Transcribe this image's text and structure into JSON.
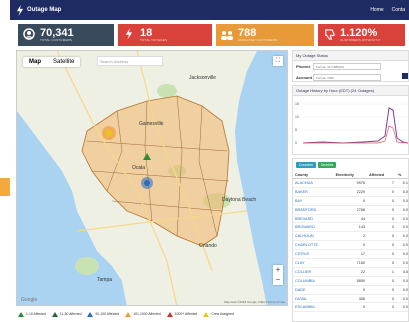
{
  "header": {
    "title": "Outage Map",
    "nav": [
      "Home",
      "Conta"
    ]
  },
  "stats": [
    {
      "icon": "user-circle-icon",
      "value": "70,341",
      "label": "TOTAL CUSTOMERS",
      "color": "#394a5c"
    },
    {
      "icon": "lightning-icon",
      "value": "18",
      "label": "TOTAL OUTAGES",
      "color": "#d9423b"
    },
    {
      "icon": "users-icon",
      "value": "788",
      "label": "AFFECTED CUSTOMERS",
      "color": "#e89a39"
    },
    {
      "icon": "thumbs-down-icon",
      "value": "1.120%",
      "label": "CUSTOMERS WITHOUT P",
      "color": "#d9423b"
    }
  ],
  "map": {
    "tabs": [
      "Map",
      "Satellite"
    ],
    "search_placeholder": "Search Address",
    "zoom_in": "+",
    "zoom_out": "−",
    "google": "Google",
    "attribution": "Map data ©2018 Google, INEGI  Terms of Use",
    "cities": [
      "Gainesville",
      "Jacksonville",
      "Ocala",
      "Orlando",
      "Tampa",
      "Daytona Beach"
    ]
  },
  "legend": [
    {
      "color": "#2e8b3f",
      "label": "1-10 Affected"
    },
    {
      "color": "#1c6b3a",
      "label": "11-50 Affected"
    },
    {
      "color": "#2b6bbf",
      "label": "51-100 Affected"
    },
    {
      "color": "#f0a030",
      "label": "101-1000 Affected"
    },
    {
      "color": "#c0392b",
      "label": "1000+ Affected"
    },
    {
      "color": "#e8c51a",
      "label": "Crew Assigned"
    }
  ],
  "outage_status": {
    "heading": "My Outage Status",
    "phone_label": "Phone#",
    "phone_placeholder": "Format: 3171985234",
    "account_label": "Account",
    "account_placeholder": "Format: 1556"
  },
  "history": {
    "heading": "Outage History by Hour (EDT) (24 Outages)",
    "y_ticks": [
      "15",
      "10",
      "5",
      "0"
    ]
  },
  "table": {
    "buttons": [
      "Counties",
      "Districts"
    ],
    "columns": [
      "County",
      "Electricity",
      "Affected",
      "%"
    ],
    "rows": [
      [
        "ALACHUA",
        "9976",
        "7",
        "0.1"
      ],
      [
        "BAKER",
        "2229",
        "0",
        "0.0"
      ],
      [
        "BAY",
        "0",
        "0",
        "0.0"
      ],
      [
        "BRADFORD",
        "2788",
        "0",
        "0.0"
      ],
      [
        "BREVARD",
        "44",
        "0",
        "0.0"
      ],
      [
        "BROWARD",
        "143",
        "0",
        "0.0"
      ],
      [
        "CALHOUN",
        "2",
        "0",
        "0.0"
      ],
      [
        "CHARLOTTE",
        "0",
        "0",
        "0.0"
      ],
      [
        "CITRUS",
        "17",
        "0",
        "0.0"
      ],
      [
        "CLAY",
        "7150",
        "0",
        "0.0"
      ],
      [
        "COLLIER",
        "22",
        "1",
        "4.5"
      ],
      [
        "COLUMBIA",
        "5890",
        "0",
        "0.0"
      ],
      [
        "DADE",
        "0",
        "0",
        "0.0"
      ],
      [
        "DUVAL",
        "308",
        "0",
        "0.0"
      ],
      [
        "ESCAMBIA",
        "0",
        "0",
        "0.0"
      ]
    ]
  }
}
